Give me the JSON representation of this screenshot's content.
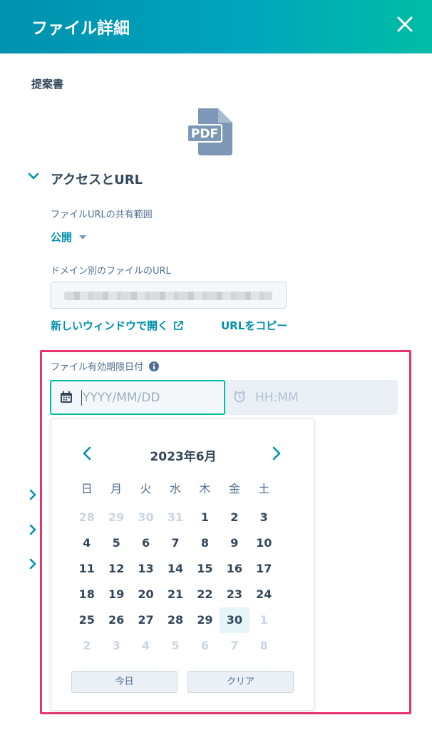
{
  "header": {
    "title": "ファイル詳細"
  },
  "file": {
    "name": "提案書",
    "icon": "pdf-file-icon",
    "icon_text": "PDF"
  },
  "access_section": {
    "title": "アクセスとURL",
    "share_label": "ファイルURLの共有範囲",
    "share_value": "公開",
    "domain_label": "ドメイン別のファイルのURL",
    "open_link": "新しいウィンドウで開く",
    "copy_link": "URLをコピー"
  },
  "expiry": {
    "label": "ファイル有効期限日付",
    "date_placeholder": "YYYY/MM/DD",
    "time_placeholder": "HH:MM"
  },
  "calendar": {
    "title": "2023年6月",
    "weekdays": [
      "日",
      "月",
      "火",
      "水",
      "木",
      "金",
      "土"
    ],
    "weeks": [
      [
        "28",
        "29",
        "30",
        "31",
        "1",
        "2",
        "3"
      ],
      [
        "4",
        "5",
        "6",
        "7",
        "8",
        "9",
        "10"
      ],
      [
        "11",
        "12",
        "13",
        "14",
        "15",
        "16",
        "17"
      ],
      [
        "18",
        "19",
        "20",
        "21",
        "22",
        "23",
        "24"
      ],
      [
        "25",
        "26",
        "27",
        "28",
        "29",
        "30",
        "1"
      ],
      [
        "2",
        "3",
        "4",
        "5",
        "6",
        "7",
        "8"
      ]
    ],
    "selected_day": "30",
    "today_button": "今日",
    "clear_button": "クリア"
  },
  "colors": {
    "accent": "#0091ae",
    "header_gradient_start": "#0091ae",
    "header_gradient_end": "#00bda5",
    "highlight_border": "#e8336c",
    "text": "#33475b"
  }
}
